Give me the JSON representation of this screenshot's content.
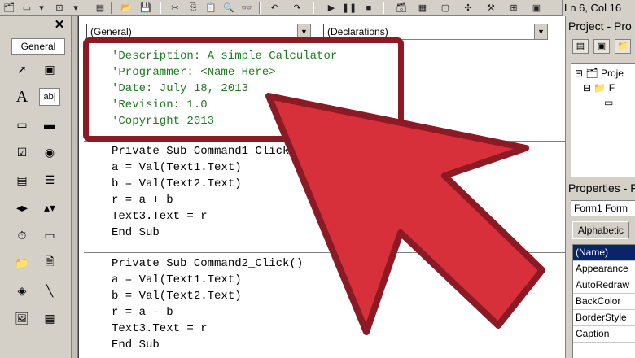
{
  "toolbar": {
    "position_text": "Ln 6, Col 16"
  },
  "toolbox": {
    "close_label": "✕",
    "group_label": "General",
    "tools": [
      {
        "name": "pointer-tool",
        "glyph": "➚"
      },
      {
        "name": "picturebox-tool",
        "glyph": "▣"
      },
      {
        "name": "label-tool",
        "glyph": "A"
      },
      {
        "name": "textbox-tool",
        "glyph": "ab|"
      },
      {
        "name": "frame-tool",
        "glyph": "▭"
      },
      {
        "name": "commandbutton-tool",
        "glyph": "▬"
      },
      {
        "name": "checkbox-tool",
        "glyph": "☑"
      },
      {
        "name": "optionbutton-tool",
        "glyph": "◉"
      },
      {
        "name": "combobox-tool",
        "glyph": "▤"
      },
      {
        "name": "listbox-tool",
        "glyph": "☰"
      },
      {
        "name": "hscrollbar-tool",
        "glyph": "◂▸"
      },
      {
        "name": "vscrollbar-tool",
        "glyph": "▴▾"
      },
      {
        "name": "timer-tool",
        "glyph": "⏱"
      },
      {
        "name": "drivelistbox-tool",
        "glyph": "▭"
      },
      {
        "name": "dirlistbox-tool",
        "glyph": "📁"
      },
      {
        "name": "filelistbox-tool",
        "glyph": "🗎"
      },
      {
        "name": "shape-tool",
        "glyph": "◈"
      },
      {
        "name": "line-tool",
        "glyph": "╲"
      },
      {
        "name": "image-tool",
        "glyph": "🖼"
      },
      {
        "name": "data-tool",
        "glyph": "▦"
      }
    ]
  },
  "code_window": {
    "object_combo": "(General)",
    "proc_combo": "(Declarations)",
    "comments": [
      "'Description: A simple Calculator",
      "'Programmer: <Name Here>",
      "'Date: July 18, 2013",
      "'Revision: 1.0",
      "'Copyright 2013"
    ],
    "proc1": [
      "Private Sub Command1_Click()",
      "a = Val(Text1.Text)",
      "b = Val(Text2.Text)",
      "r = a + b",
      "Text3.Text = r",
      "End Sub"
    ],
    "proc2": [
      "Private Sub Command2_Click()",
      "a = Val(Text1.Text)",
      "b = Val(Text2.Text)",
      "r = a - b",
      "Text3.Text = r",
      "End Sub"
    ]
  },
  "project_panel": {
    "title": "Project - Pro",
    "tree_root": "Proje",
    "tree_folder": "F"
  },
  "properties_panel": {
    "title": "Properties - F",
    "object": "Form1 Form",
    "tab_label": "Alphabetic",
    "rows": [
      "(Name)",
      "Appearance",
      "AutoRedraw",
      "BackColor",
      "BorderStyle",
      "Caption"
    ],
    "selected_row": "(Name)"
  },
  "colors": {
    "highlight_box": "#8c1a25",
    "arrow_fill": "#d7303b",
    "arrow_stroke": "#8c1a25",
    "comment_text": "#1f7a1f",
    "selection": "#0a246a"
  }
}
